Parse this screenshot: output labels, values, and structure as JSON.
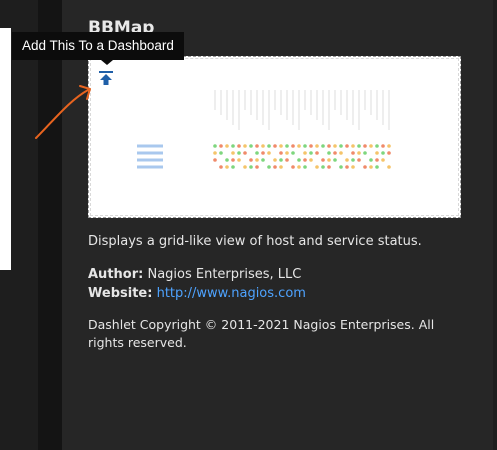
{
  "dashlet": {
    "title": "BBMap",
    "tooltip": "Add This To a Dashboard",
    "add_icon": "add-to-dashboard-icon",
    "description": "Displays a grid-like view of host and service status.",
    "author_label": "Author:",
    "author_value": "Nagios Enterprises, LLC",
    "website_label": "Website:",
    "website_value": "http://www.nagios.com",
    "copyright": "Dashlet Copyright © 2011-2021 Nagios Enterprises. All rights reserved."
  },
  "colors": {
    "background": "#1e1e1e",
    "card": "#262626",
    "link": "#4ea3ff",
    "annotation": "#e8641f",
    "status_ok": "#7ed67e",
    "status_warning": "#f5c46a",
    "status_critical": "#f08a6a"
  }
}
